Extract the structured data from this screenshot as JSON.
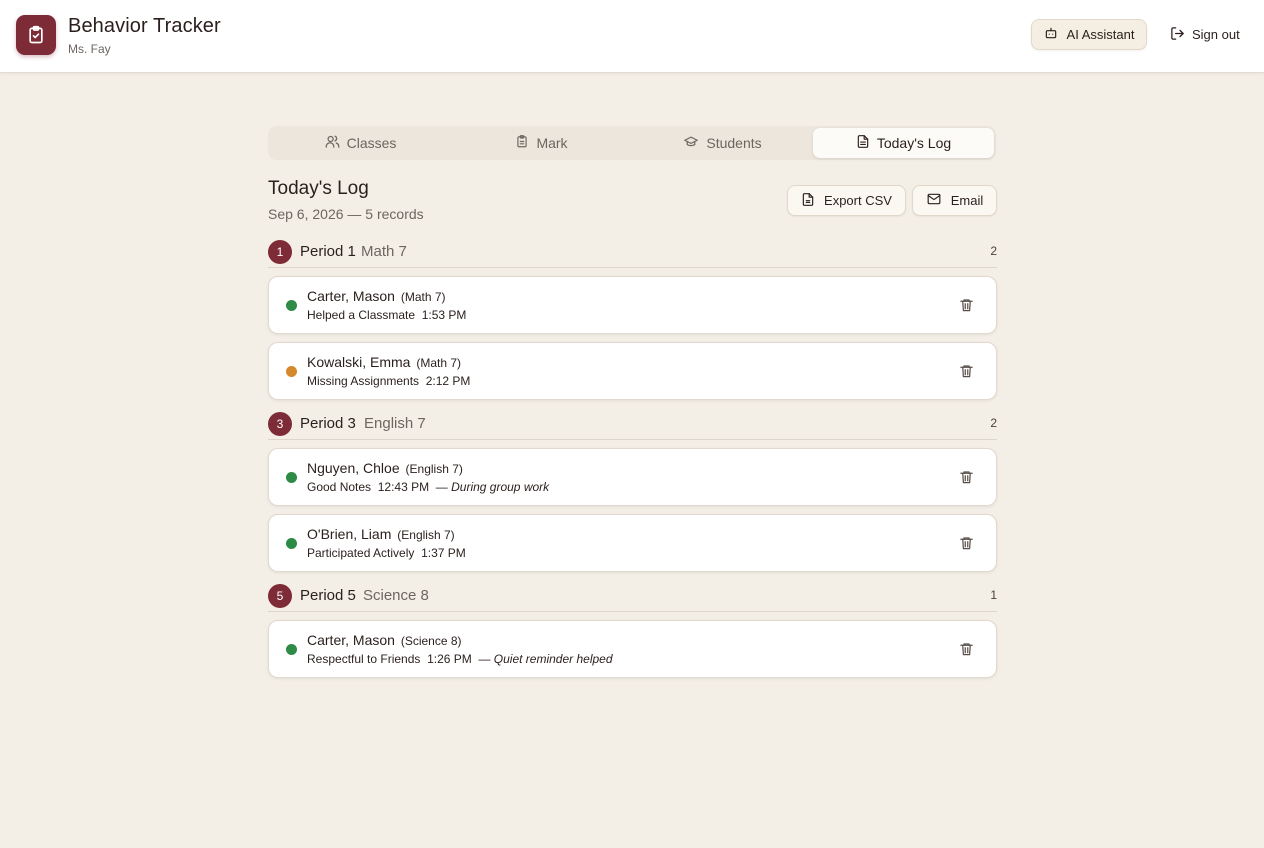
{
  "app": {
    "title": "Behavior Tracker",
    "user": "Ms. Fay",
    "brand_color": "#7d2b36"
  },
  "header": {
    "ai_label": "AI Assistant",
    "signout_label": "Sign out"
  },
  "tabs": [
    {
      "label": "Classes",
      "icon": "users-icon",
      "active": false
    },
    {
      "label": "Mark",
      "icon": "clipboard-icon",
      "active": false
    },
    {
      "label": "Students",
      "icon": "graduation-cap-icon",
      "active": false
    },
    {
      "label": "Today's Log",
      "icon": "document-icon",
      "active": true
    }
  ],
  "log": {
    "title": "Today's Log",
    "subtitle": "Sep 6, 2026 — 5 records",
    "export_label": "Export CSV",
    "email_label": "Email"
  },
  "periods": [
    {
      "num": "1",
      "name": "Period 1",
      "subject": "Math 7",
      "count": "2",
      "records": [
        {
          "student": "Carter, Mason",
          "class": "(Math 7)",
          "behavior": "Helped a Classmate",
          "time": "1:53 PM",
          "note": "",
          "status_color": "#2e8b45"
        },
        {
          "student": "Kowalski, Emma",
          "class": "(Math 7)",
          "behavior": "Missing Assignments",
          "time": "2:12 PM",
          "note": "",
          "status_color": "#d4892b"
        }
      ]
    },
    {
      "num": "3",
      "name": "Period 3",
      "subject": "English 7",
      "count": "2",
      "records": [
        {
          "student": "Nguyen, Chloe",
          "class": "(English 7)",
          "behavior": "Good Notes",
          "time": "12:43 PM",
          "note": "During group work",
          "status_color": "#2e8b45"
        },
        {
          "student": "O'Brien, Liam",
          "class": "(English 7)",
          "behavior": "Participated Actively",
          "time": "1:37 PM",
          "note": "",
          "status_color": "#2e8b45"
        }
      ]
    },
    {
      "num": "5",
      "name": "Period 5",
      "subject": "Science 8",
      "count": "1",
      "records": [
        {
          "student": "Carter, Mason",
          "class": "(Science 8)",
          "behavior": "Respectful to Friends",
          "time": "1:26 PM",
          "note": "Quiet reminder helped",
          "status_color": "#2e8b45"
        }
      ]
    }
  ]
}
